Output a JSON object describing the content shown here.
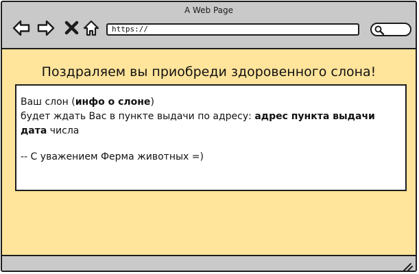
{
  "window": {
    "title": "A Web Page"
  },
  "toolbar": {
    "back_icon": "back-arrow-icon",
    "forward_icon": "forward-arrow-icon",
    "close_icon": "close-x-icon",
    "home_icon": "home-icon",
    "url": "https://",
    "search_icon": "search-icon"
  },
  "page": {
    "headline": "Поздраляем вы приобреди здоровенного слона!",
    "message": {
      "line1_prefix": "Ваш слон (",
      "line1_bold": "инфо о слоне",
      "line1_suffix": ")",
      "line2_prefix": "будет ждать Вас в пункте выдачи по адресу: ",
      "line2_bold": "адрес пункта выдачи",
      "line3_bold": "дата",
      "line3_suffix": " числа",
      "signature": "-- С уважением Ферма животных =)"
    }
  },
  "colors": {
    "content_background": "#ffe49b",
    "chrome_background": "#c9c9c9",
    "border": "#1c1c1c"
  }
}
